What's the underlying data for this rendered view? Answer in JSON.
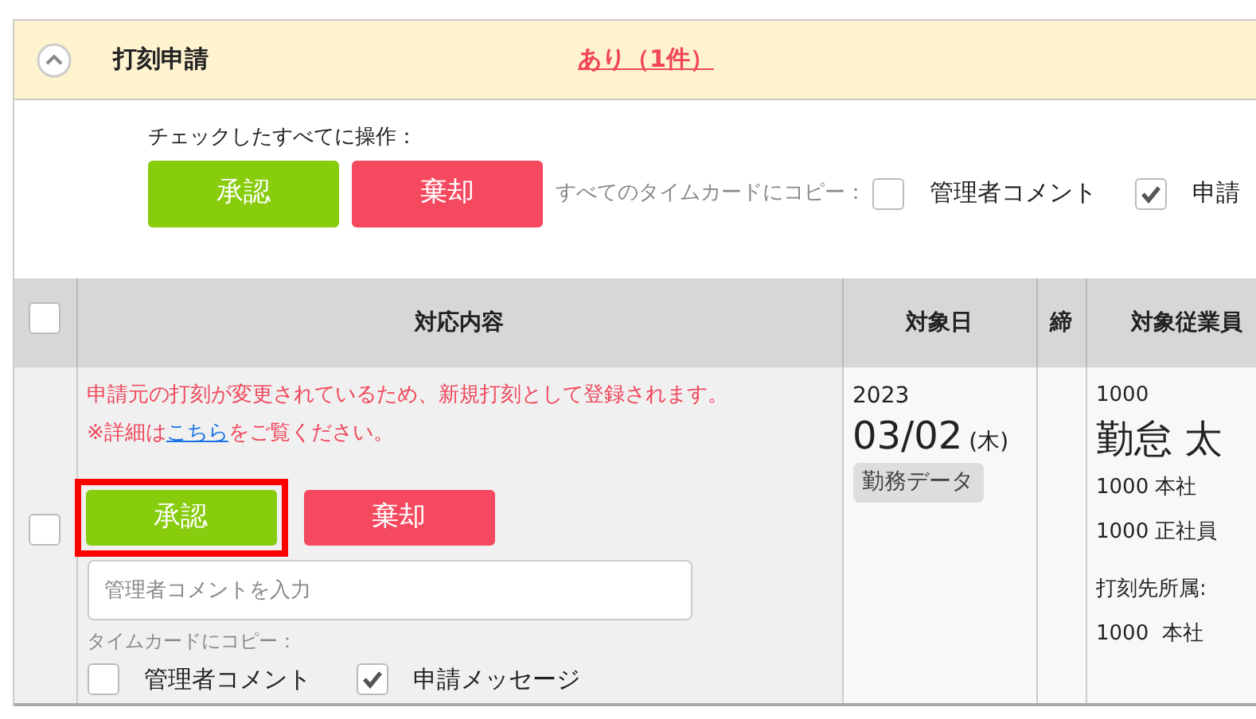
{
  "section": {
    "title": "打刻申請",
    "status_link": "あり（1件）",
    "expanded": true
  },
  "bulk": {
    "label": "チェックしたすべてに操作：",
    "approve": "承認",
    "reject": "棄却",
    "copy_label": "すべてのタイムカードにコピー：",
    "copy_options": [
      {
        "label": "管理者コメント",
        "checked": false
      },
      {
        "label": "申請",
        "checked": true
      }
    ]
  },
  "table": {
    "select_all": {
      "checked": false
    },
    "columns": [
      "対応内容",
      "対象日",
      "締",
      "対象従業員"
    ],
    "rows": [
      {
        "selected": false,
        "warning": "申請元の打刻が変更されているため、新規打刻として登録されます。",
        "detail_before": "※詳細は",
        "detail_link": "こちら",
        "detail_after": "をご覧ください。",
        "approve": "承認",
        "approve_highlighted": true,
        "reject": "棄却",
        "comment_placeholder": "管理者コメントを入力",
        "copy_label": "タイムカードにコピー：",
        "copy_options": [
          {
            "label": "管理者コメント",
            "checked": false
          },
          {
            "label": "申請メッセージ",
            "checked": true
          }
        ],
        "year": "2023",
        "date": "03/02",
        "weekday": "(木)",
        "data_tag": "勤務データ",
        "employee_code": "1000",
        "employee_name": "勤怠 太",
        "office": "1000 本社",
        "employment_type": "1000 正社員",
        "stamp_label": "打刻先所属:",
        "stamp_office": "1000  本社"
      }
    ]
  }
}
